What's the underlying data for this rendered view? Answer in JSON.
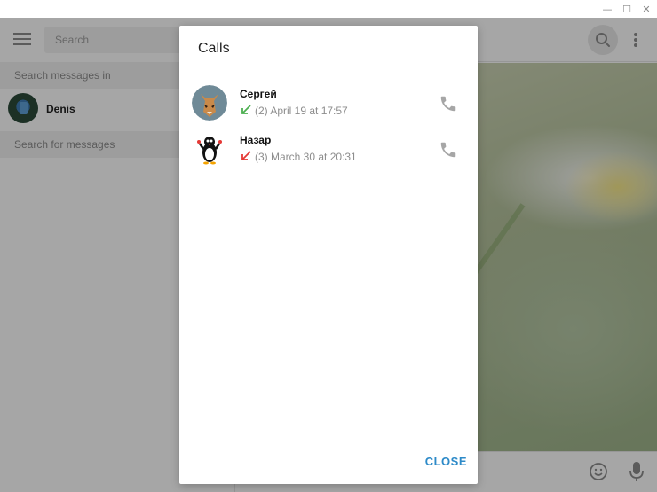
{
  "window": {
    "controls": {
      "minimize": "—",
      "maximize": "☐",
      "close": "✕"
    }
  },
  "sidebar": {
    "search_placeholder": "Search",
    "search_in_label": "Search messages in",
    "chat": {
      "name": "Denis"
    },
    "search_for_label": "Search for messages"
  },
  "dialog": {
    "title": "Calls",
    "calls": [
      {
        "name": "Сергей",
        "info": "(2) April 19 at 17:57",
        "direction": "incoming",
        "arrow_color": "#4caf50"
      },
      {
        "name": "Назар",
        "info": "(3) March 30 at 20:31",
        "direction": "missed",
        "arrow_color": "#e53935"
      }
    ],
    "close_label": "CLOSE"
  },
  "colors": {
    "accent": "#2d8ac8",
    "overlay": "rgba(0,0,0,0.35)",
    "icon_gray": "#8d8d8d"
  },
  "icons": {
    "menu": "hamburger-icon",
    "search": "search-icon",
    "more": "more-vertical-icon",
    "phone": "phone-icon",
    "emoji": "emoji-icon",
    "mic": "microphone-icon"
  }
}
